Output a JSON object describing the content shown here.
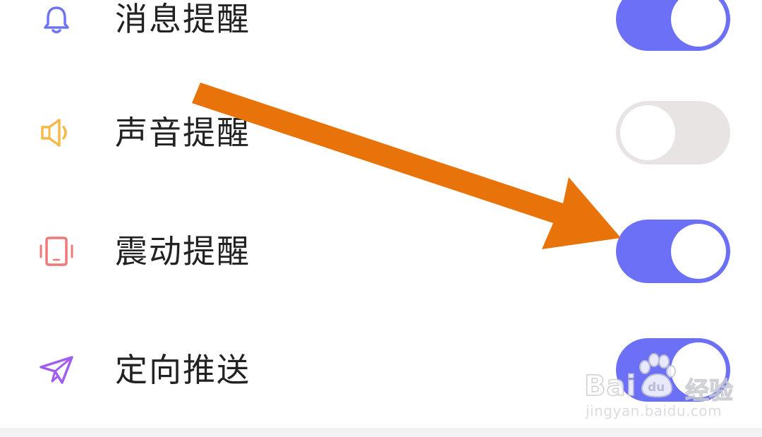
{
  "settings": [
    {
      "label": "消息提醒",
      "icon": "bell-icon",
      "toggle_on": true,
      "icon_color": "#6d74f2"
    },
    {
      "label": "声音提醒",
      "icon": "speaker-icon",
      "toggle_on": false,
      "icon_color": "#f6b94a"
    },
    {
      "label": "震动提醒",
      "icon": "vibrate-phone-icon",
      "toggle_on": true,
      "icon_color": "#f07878"
    },
    {
      "label": "定向推送",
      "icon": "paper-plane-icon",
      "toggle_on": true,
      "icon_color": "#a15cf0"
    }
  ],
  "colors": {
    "toggle_on": "#6b70f7",
    "toggle_off": "#e8e4e4",
    "arrow": "#e8730a"
  },
  "watermark": {
    "brand": "Bai",
    "brand_suffix": "du",
    "brand_cn": "经验",
    "url": "jingyan.baidu.com"
  }
}
